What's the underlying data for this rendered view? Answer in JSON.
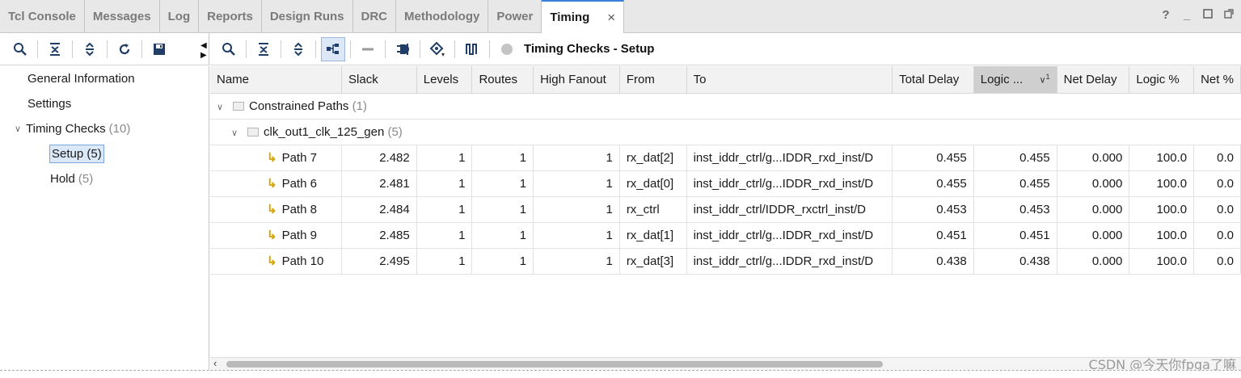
{
  "tabs": [
    {
      "label": "Tcl Console"
    },
    {
      "label": "Messages"
    },
    {
      "label": "Log"
    },
    {
      "label": "Reports"
    },
    {
      "label": "Design Runs"
    },
    {
      "label": "DRC"
    },
    {
      "label": "Methodology"
    },
    {
      "label": "Power"
    },
    {
      "label": "Timing",
      "active": true
    }
  ],
  "window_controls": {
    "help": "?",
    "minimize": "_"
  },
  "toolbar": {
    "panel_title": "Timing Checks - Setup"
  },
  "tree": {
    "general_info": "General Information",
    "settings": "Settings",
    "timing_checks": "Timing Checks",
    "timing_checks_count": "(10)",
    "setup": "Setup",
    "setup_count": "(5)",
    "hold": "Hold",
    "hold_count": "(5)"
  },
  "table": {
    "columns": [
      "Name",
      "Slack",
      "Levels",
      "Routes",
      "High Fanout",
      "From",
      "To",
      "Total Delay",
      "Logic ...",
      "Net Delay",
      "Logic %",
      "Net %"
    ],
    "sort_indicator": "1",
    "group": {
      "label": "Constrained Paths",
      "count": "(1)"
    },
    "clock": {
      "label": "clk_out1_clk_125_gen",
      "count": "(5)"
    },
    "rows": [
      {
        "name": "Path 7",
        "slack": "2.482",
        "levels": "1",
        "routes": "1",
        "fanout": "1",
        "from": "rx_dat[2]",
        "to": "inst_iddr_ctrl/g...IDDR_rxd_inst/D",
        "total": "0.455",
        "logic": "0.455",
        "net": "0.000",
        "logic_pct": "100.0",
        "net_pct": "0.0"
      },
      {
        "name": "Path 6",
        "slack": "2.481",
        "levels": "1",
        "routes": "1",
        "fanout": "1",
        "from": "rx_dat[0]",
        "to": "inst_iddr_ctrl/g...IDDR_rxd_inst/D",
        "total": "0.455",
        "logic": "0.455",
        "net": "0.000",
        "logic_pct": "100.0",
        "net_pct": "0.0"
      },
      {
        "name": "Path 8",
        "slack": "2.484",
        "levels": "1",
        "routes": "1",
        "fanout": "1",
        "from": "rx_ctrl",
        "to": "inst_iddr_ctrl/IDDR_rxctrl_inst/D",
        "total": "0.453",
        "logic": "0.453",
        "net": "0.000",
        "logic_pct": "100.0",
        "net_pct": "0.0"
      },
      {
        "name": "Path 9",
        "slack": "2.485",
        "levels": "1",
        "routes": "1",
        "fanout": "1",
        "from": "rx_dat[1]",
        "to": "inst_iddr_ctrl/g...IDDR_rxd_inst/D",
        "total": "0.451",
        "logic": "0.451",
        "net": "0.000",
        "logic_pct": "100.0",
        "net_pct": "0.0"
      },
      {
        "name": "Path 10",
        "slack": "2.495",
        "levels": "1",
        "routes": "1",
        "fanout": "1",
        "from": "rx_dat[3]",
        "to": "inst_iddr_ctrl/g...IDDR_rxd_inst/D",
        "total": "0.438",
        "logic": "0.438",
        "net": "0.000",
        "logic_pct": "100.0",
        "net_pct": "0.0"
      }
    ]
  },
  "watermark": "CSDN @今天你fpga了嘛",
  "colors": {
    "accent": "#3c7fd6",
    "path_icon": "#d9a400",
    "selected_bg": "#dbe8f8"
  }
}
